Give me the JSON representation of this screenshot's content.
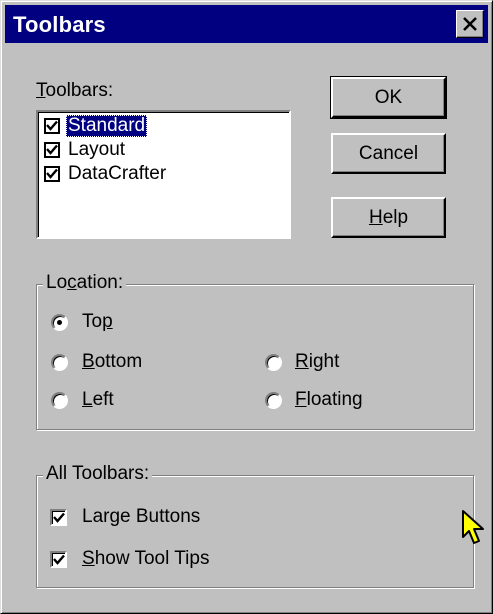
{
  "window": {
    "title": "Toolbars"
  },
  "toolbars_label": {
    "before": "",
    "mnemonic": "T",
    "after": "oolbars:"
  },
  "toolbars_list": [
    {
      "label": "Standard",
      "checked": true,
      "selected": true
    },
    {
      "label": "Layout",
      "checked": true,
      "selected": false
    },
    {
      "label": "DataCrafter",
      "checked": true,
      "selected": false
    }
  ],
  "buttons": {
    "ok": "OK",
    "cancel": "Cancel",
    "help": {
      "before": "",
      "mnemonic": "H",
      "after": "elp"
    }
  },
  "location": {
    "legend": {
      "before": "Lo",
      "mnemonic": "c",
      "after": "ation:"
    },
    "selected": "Top",
    "options": {
      "top": {
        "before": "To",
        "mnemonic": "p",
        "after": ""
      },
      "bottom": {
        "before": "",
        "mnemonic": "B",
        "after": "ottom"
      },
      "left": {
        "before": "",
        "mnemonic": "L",
        "after": "eft"
      },
      "right": {
        "before": "",
        "mnemonic": "R",
        "after": "ight"
      },
      "floating": {
        "before": "",
        "mnemonic": "F",
        "after": "loating"
      }
    }
  },
  "all_toolbars": {
    "legend": "All Toolbars:",
    "large_buttons": {
      "before": "",
      "mnemonic": "",
      "after": "Large Buttons",
      "checked": true
    },
    "show_tool_tips": {
      "before": "",
      "mnemonic": "S",
      "after": "how Tool Tips",
      "checked": true
    }
  },
  "colors": {
    "titlebar": "#000080",
    "face": "#c0c0c0",
    "selection": "#000080",
    "cursor": "#ffff00"
  }
}
